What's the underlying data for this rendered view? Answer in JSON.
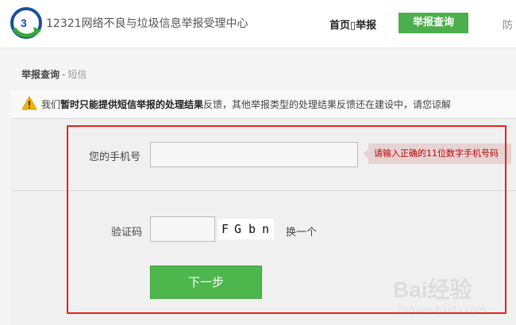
{
  "header": {
    "site_name": "12321网络不良与垃圾信息举报受理中心",
    "nav": {
      "home": "首页▯举报",
      "query": "举报查询",
      "partial": "防"
    }
  },
  "breadcrumb": {
    "main": "举报查询",
    "separator": "-",
    "sub": "短信"
  },
  "notice": {
    "prefix": "我们",
    "bold": "暂时只能提供短信举报的处理结果",
    "suffix": "反馈，其他举报类型的处理结果反馈还在建设中，请您谅解"
  },
  "form": {
    "phone_label": "您的手机号",
    "phone_value": "",
    "phone_tip": "请输入正确的11位数字手机号码",
    "captcha_label": "验证码",
    "captcha_value": "",
    "captcha_chars": [
      "F",
      "G",
      "b",
      "n"
    ],
    "refresh_label": "换一个",
    "next_label": "下一步"
  },
  "watermark": {
    "main": "Bai经验",
    "sub": "jingyan.baidu.com"
  },
  "colors": {
    "accent_green": "#4cae4c",
    "highlight_red": "#e8221c",
    "tip_text": "#c00000"
  },
  "icons": {
    "logo": "12321-logo-icon",
    "warning": "warning-triangle-icon"
  }
}
